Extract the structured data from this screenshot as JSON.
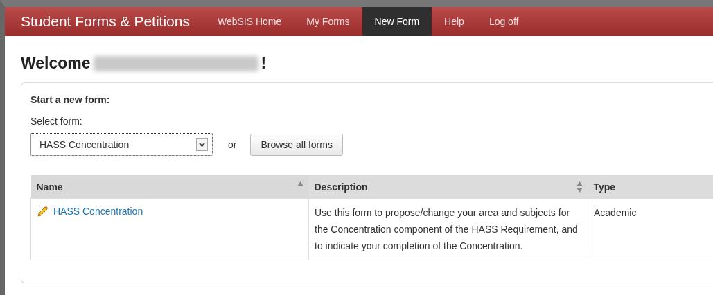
{
  "navbar": {
    "brand": "Student Forms & Petitions",
    "items": [
      {
        "label": "WebSIS Home",
        "selected": false
      },
      {
        "label": "My Forms",
        "selected": false
      },
      {
        "label": "New Form",
        "selected": true
      },
      {
        "label": "Help",
        "selected": false
      },
      {
        "label": "Log off",
        "selected": false
      }
    ]
  },
  "welcome": {
    "greeting": "Welcome",
    "punctuation": "!"
  },
  "new_form": {
    "heading": "Start a new form:",
    "select_label": "Select form:",
    "select_value": "HASS Concentration",
    "or_text": "or",
    "browse_button": "Browse all forms"
  },
  "table": {
    "columns": [
      {
        "label": "Name",
        "sortable": true,
        "sorted": true
      },
      {
        "label": "Description",
        "sortable": true,
        "sorted": false
      },
      {
        "label": "Type",
        "sortable": false
      }
    ],
    "rows": [
      {
        "name": "HASS Concentration",
        "description": "Use this form to propose/change your area and subjects for the Concentration component of the HASS Requirement, and to indicate your completion of the Concentration.",
        "type": "Academic"
      }
    ]
  }
}
